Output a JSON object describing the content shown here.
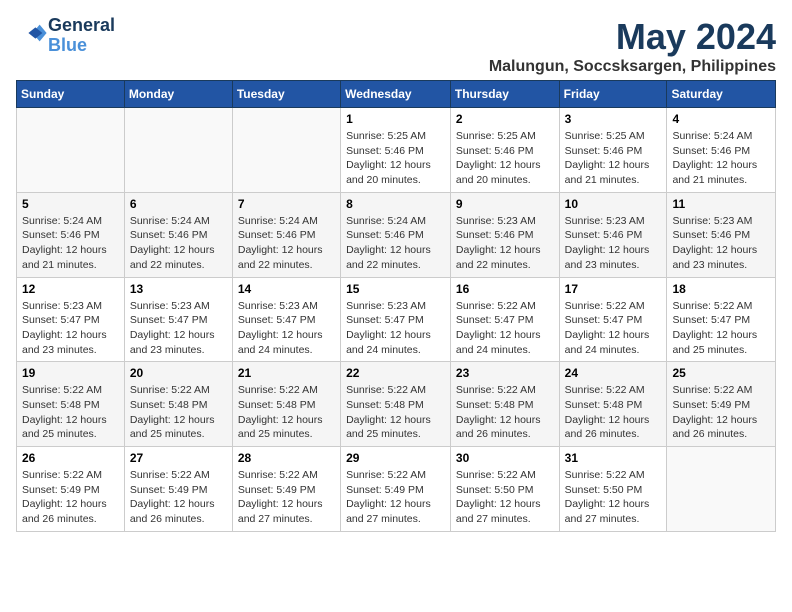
{
  "header": {
    "logo_line1": "General",
    "logo_line2": "Blue",
    "month": "May 2024",
    "location": "Malungun, Soccsksargen, Philippines"
  },
  "days_of_week": [
    "Sunday",
    "Monday",
    "Tuesday",
    "Wednesday",
    "Thursday",
    "Friday",
    "Saturday"
  ],
  "weeks": [
    [
      {
        "day": "",
        "info": ""
      },
      {
        "day": "",
        "info": ""
      },
      {
        "day": "",
        "info": ""
      },
      {
        "day": "1",
        "info": "Sunrise: 5:25 AM\nSunset: 5:46 PM\nDaylight: 12 hours\nand 20 minutes."
      },
      {
        "day": "2",
        "info": "Sunrise: 5:25 AM\nSunset: 5:46 PM\nDaylight: 12 hours\nand 20 minutes."
      },
      {
        "day": "3",
        "info": "Sunrise: 5:25 AM\nSunset: 5:46 PM\nDaylight: 12 hours\nand 21 minutes."
      },
      {
        "day": "4",
        "info": "Sunrise: 5:24 AM\nSunset: 5:46 PM\nDaylight: 12 hours\nand 21 minutes."
      }
    ],
    [
      {
        "day": "5",
        "info": "Sunrise: 5:24 AM\nSunset: 5:46 PM\nDaylight: 12 hours\nand 21 minutes."
      },
      {
        "day": "6",
        "info": "Sunrise: 5:24 AM\nSunset: 5:46 PM\nDaylight: 12 hours\nand 22 minutes."
      },
      {
        "day": "7",
        "info": "Sunrise: 5:24 AM\nSunset: 5:46 PM\nDaylight: 12 hours\nand 22 minutes."
      },
      {
        "day": "8",
        "info": "Sunrise: 5:24 AM\nSunset: 5:46 PM\nDaylight: 12 hours\nand 22 minutes."
      },
      {
        "day": "9",
        "info": "Sunrise: 5:23 AM\nSunset: 5:46 PM\nDaylight: 12 hours\nand 22 minutes."
      },
      {
        "day": "10",
        "info": "Sunrise: 5:23 AM\nSunset: 5:46 PM\nDaylight: 12 hours\nand 23 minutes."
      },
      {
        "day": "11",
        "info": "Sunrise: 5:23 AM\nSunset: 5:46 PM\nDaylight: 12 hours\nand 23 minutes."
      }
    ],
    [
      {
        "day": "12",
        "info": "Sunrise: 5:23 AM\nSunset: 5:47 PM\nDaylight: 12 hours\nand 23 minutes."
      },
      {
        "day": "13",
        "info": "Sunrise: 5:23 AM\nSunset: 5:47 PM\nDaylight: 12 hours\nand 23 minutes."
      },
      {
        "day": "14",
        "info": "Sunrise: 5:23 AM\nSunset: 5:47 PM\nDaylight: 12 hours\nand 24 minutes."
      },
      {
        "day": "15",
        "info": "Sunrise: 5:23 AM\nSunset: 5:47 PM\nDaylight: 12 hours\nand 24 minutes."
      },
      {
        "day": "16",
        "info": "Sunrise: 5:22 AM\nSunset: 5:47 PM\nDaylight: 12 hours\nand 24 minutes."
      },
      {
        "day": "17",
        "info": "Sunrise: 5:22 AM\nSunset: 5:47 PM\nDaylight: 12 hours\nand 24 minutes."
      },
      {
        "day": "18",
        "info": "Sunrise: 5:22 AM\nSunset: 5:47 PM\nDaylight: 12 hours\nand 25 minutes."
      }
    ],
    [
      {
        "day": "19",
        "info": "Sunrise: 5:22 AM\nSunset: 5:48 PM\nDaylight: 12 hours\nand 25 minutes."
      },
      {
        "day": "20",
        "info": "Sunrise: 5:22 AM\nSunset: 5:48 PM\nDaylight: 12 hours\nand 25 minutes."
      },
      {
        "day": "21",
        "info": "Sunrise: 5:22 AM\nSunset: 5:48 PM\nDaylight: 12 hours\nand 25 minutes."
      },
      {
        "day": "22",
        "info": "Sunrise: 5:22 AM\nSunset: 5:48 PM\nDaylight: 12 hours\nand 25 minutes."
      },
      {
        "day": "23",
        "info": "Sunrise: 5:22 AM\nSunset: 5:48 PM\nDaylight: 12 hours\nand 26 minutes."
      },
      {
        "day": "24",
        "info": "Sunrise: 5:22 AM\nSunset: 5:48 PM\nDaylight: 12 hours\nand 26 minutes."
      },
      {
        "day": "25",
        "info": "Sunrise: 5:22 AM\nSunset: 5:49 PM\nDaylight: 12 hours\nand 26 minutes."
      }
    ],
    [
      {
        "day": "26",
        "info": "Sunrise: 5:22 AM\nSunset: 5:49 PM\nDaylight: 12 hours\nand 26 minutes."
      },
      {
        "day": "27",
        "info": "Sunrise: 5:22 AM\nSunset: 5:49 PM\nDaylight: 12 hours\nand 26 minutes."
      },
      {
        "day": "28",
        "info": "Sunrise: 5:22 AM\nSunset: 5:49 PM\nDaylight: 12 hours\nand 27 minutes."
      },
      {
        "day": "29",
        "info": "Sunrise: 5:22 AM\nSunset: 5:49 PM\nDaylight: 12 hours\nand 27 minutes."
      },
      {
        "day": "30",
        "info": "Sunrise: 5:22 AM\nSunset: 5:50 PM\nDaylight: 12 hours\nand 27 minutes."
      },
      {
        "day": "31",
        "info": "Sunrise: 5:22 AM\nSunset: 5:50 PM\nDaylight: 12 hours\nand 27 minutes."
      },
      {
        "day": "",
        "info": ""
      }
    ]
  ]
}
